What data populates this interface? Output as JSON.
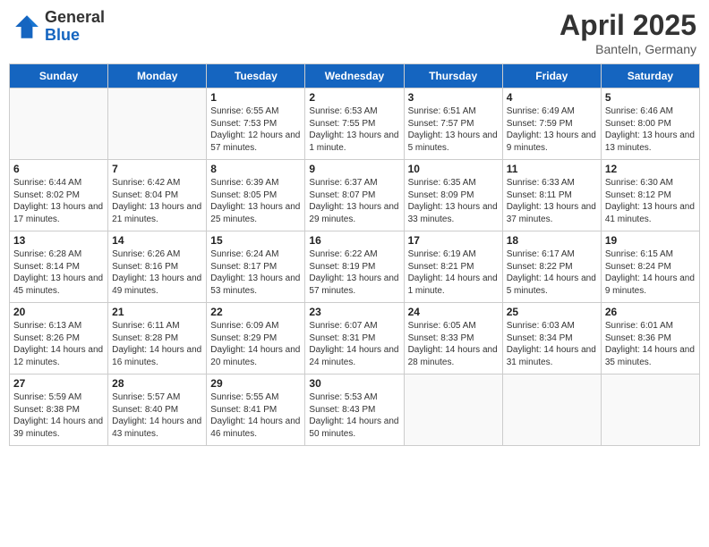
{
  "header": {
    "logo_general": "General",
    "logo_blue": "Blue",
    "title": "April 2025",
    "location": "Banteln, Germany"
  },
  "days_of_week": [
    "Sunday",
    "Monday",
    "Tuesday",
    "Wednesday",
    "Thursday",
    "Friday",
    "Saturday"
  ],
  "weeks": [
    [
      {
        "day": "",
        "info": ""
      },
      {
        "day": "",
        "info": ""
      },
      {
        "day": "1",
        "info": "Sunrise: 6:55 AM\nSunset: 7:53 PM\nDaylight: 12 hours and 57 minutes."
      },
      {
        "day": "2",
        "info": "Sunrise: 6:53 AM\nSunset: 7:55 PM\nDaylight: 13 hours and 1 minute."
      },
      {
        "day": "3",
        "info": "Sunrise: 6:51 AM\nSunset: 7:57 PM\nDaylight: 13 hours and 5 minutes."
      },
      {
        "day": "4",
        "info": "Sunrise: 6:49 AM\nSunset: 7:59 PM\nDaylight: 13 hours and 9 minutes."
      },
      {
        "day": "5",
        "info": "Sunrise: 6:46 AM\nSunset: 8:00 PM\nDaylight: 13 hours and 13 minutes."
      }
    ],
    [
      {
        "day": "6",
        "info": "Sunrise: 6:44 AM\nSunset: 8:02 PM\nDaylight: 13 hours and 17 minutes."
      },
      {
        "day": "7",
        "info": "Sunrise: 6:42 AM\nSunset: 8:04 PM\nDaylight: 13 hours and 21 minutes."
      },
      {
        "day": "8",
        "info": "Sunrise: 6:39 AM\nSunset: 8:05 PM\nDaylight: 13 hours and 25 minutes."
      },
      {
        "day": "9",
        "info": "Sunrise: 6:37 AM\nSunset: 8:07 PM\nDaylight: 13 hours and 29 minutes."
      },
      {
        "day": "10",
        "info": "Sunrise: 6:35 AM\nSunset: 8:09 PM\nDaylight: 13 hours and 33 minutes."
      },
      {
        "day": "11",
        "info": "Sunrise: 6:33 AM\nSunset: 8:11 PM\nDaylight: 13 hours and 37 minutes."
      },
      {
        "day": "12",
        "info": "Sunrise: 6:30 AM\nSunset: 8:12 PM\nDaylight: 13 hours and 41 minutes."
      }
    ],
    [
      {
        "day": "13",
        "info": "Sunrise: 6:28 AM\nSunset: 8:14 PM\nDaylight: 13 hours and 45 minutes."
      },
      {
        "day": "14",
        "info": "Sunrise: 6:26 AM\nSunset: 8:16 PM\nDaylight: 13 hours and 49 minutes."
      },
      {
        "day": "15",
        "info": "Sunrise: 6:24 AM\nSunset: 8:17 PM\nDaylight: 13 hours and 53 minutes."
      },
      {
        "day": "16",
        "info": "Sunrise: 6:22 AM\nSunset: 8:19 PM\nDaylight: 13 hours and 57 minutes."
      },
      {
        "day": "17",
        "info": "Sunrise: 6:19 AM\nSunset: 8:21 PM\nDaylight: 14 hours and 1 minute."
      },
      {
        "day": "18",
        "info": "Sunrise: 6:17 AM\nSunset: 8:22 PM\nDaylight: 14 hours and 5 minutes."
      },
      {
        "day": "19",
        "info": "Sunrise: 6:15 AM\nSunset: 8:24 PM\nDaylight: 14 hours and 9 minutes."
      }
    ],
    [
      {
        "day": "20",
        "info": "Sunrise: 6:13 AM\nSunset: 8:26 PM\nDaylight: 14 hours and 12 minutes."
      },
      {
        "day": "21",
        "info": "Sunrise: 6:11 AM\nSunset: 8:28 PM\nDaylight: 14 hours and 16 minutes."
      },
      {
        "day": "22",
        "info": "Sunrise: 6:09 AM\nSunset: 8:29 PM\nDaylight: 14 hours and 20 minutes."
      },
      {
        "day": "23",
        "info": "Sunrise: 6:07 AM\nSunset: 8:31 PM\nDaylight: 14 hours and 24 minutes."
      },
      {
        "day": "24",
        "info": "Sunrise: 6:05 AM\nSunset: 8:33 PM\nDaylight: 14 hours and 28 minutes."
      },
      {
        "day": "25",
        "info": "Sunrise: 6:03 AM\nSunset: 8:34 PM\nDaylight: 14 hours and 31 minutes."
      },
      {
        "day": "26",
        "info": "Sunrise: 6:01 AM\nSunset: 8:36 PM\nDaylight: 14 hours and 35 minutes."
      }
    ],
    [
      {
        "day": "27",
        "info": "Sunrise: 5:59 AM\nSunset: 8:38 PM\nDaylight: 14 hours and 39 minutes."
      },
      {
        "day": "28",
        "info": "Sunrise: 5:57 AM\nSunset: 8:40 PM\nDaylight: 14 hours and 43 minutes."
      },
      {
        "day": "29",
        "info": "Sunrise: 5:55 AM\nSunset: 8:41 PM\nDaylight: 14 hours and 46 minutes."
      },
      {
        "day": "30",
        "info": "Sunrise: 5:53 AM\nSunset: 8:43 PM\nDaylight: 14 hours and 50 minutes."
      },
      {
        "day": "",
        "info": ""
      },
      {
        "day": "",
        "info": ""
      },
      {
        "day": "",
        "info": ""
      }
    ]
  ]
}
